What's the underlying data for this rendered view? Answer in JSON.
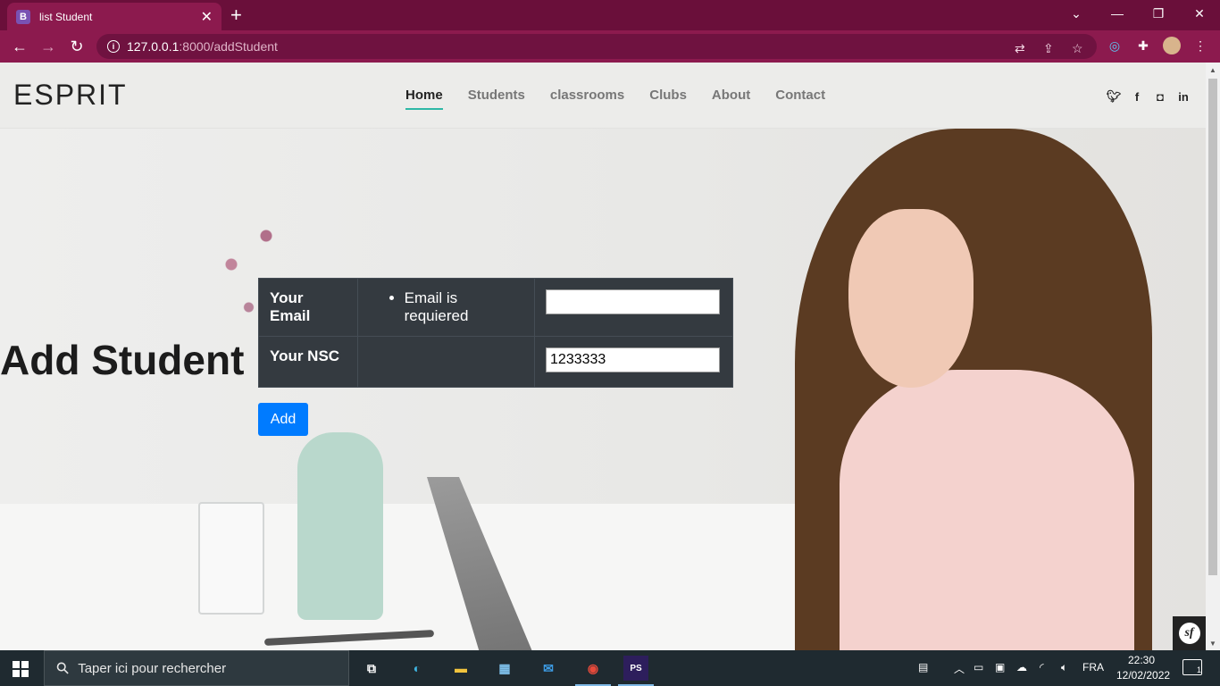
{
  "browser": {
    "tab_title": "list Student",
    "tab_favicon": "B",
    "url_host": "127.0.0.1",
    "url_path": ":8000/addStudent"
  },
  "site": {
    "brand": "ESPRIT",
    "nav": [
      "Home",
      "Students",
      "classrooms",
      "Clubs",
      "About",
      "Contact"
    ],
    "active_nav": "Home",
    "social_icons": [
      "twitter-icon",
      "facebook-icon",
      "instagram-icon",
      "linkedin-icon"
    ]
  },
  "page": {
    "title": "Add Student"
  },
  "form": {
    "email_label": "Your Email",
    "email_error": "Email is requiered",
    "email_value": "",
    "nsc_label": "Your NSC",
    "nsc_value": "1233333",
    "submit_label": "Add"
  },
  "taskbar": {
    "search_placeholder": "Taper ici pour rechercher",
    "language": "FRA",
    "time": "22:30",
    "date": "12/02/2022",
    "notifications": "1"
  },
  "colors": {
    "browser_frame": "#8c1a4e",
    "primary_button": "#007bff",
    "table_bg": "#343a40",
    "nav_accent": "#2eb8a6"
  }
}
